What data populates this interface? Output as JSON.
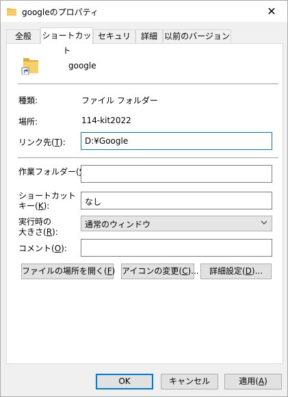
{
  "window": {
    "title": "googleのプロパティ",
    "close_glyph": "✕"
  },
  "tabs": [
    {
      "label": "全般"
    },
    {
      "label": "ショートカット",
      "active": true
    },
    {
      "label": "セキュリティ"
    },
    {
      "label": "詳細"
    },
    {
      "label": "以前のバージョン"
    }
  ],
  "header": {
    "name": "google"
  },
  "fields": {
    "type_label": "種類:",
    "type_value": "ファイル フォルダー",
    "location_label": "場所:",
    "location_value": "114-kit2022",
    "target_label_pre": "リンク先(",
    "target_label_key": "T",
    "target_label_post": "):",
    "target_value": "D:¥Google",
    "workdir_label_pre": "作業フォルダー(",
    "workdir_label_key": "S",
    "workdir_label_post": "):",
    "workdir_value": "",
    "shortcut_label_line1": "ショートカット",
    "shortcut_label_pre": "キー(",
    "shortcut_label_key": "K",
    "shortcut_label_post": "):",
    "shortcut_value": "なし",
    "run_label_line1": "実行時の",
    "run_label_pre": "大きさ(",
    "run_label_key": "R",
    "run_label_post": "):",
    "run_value": "通常のウィンドウ",
    "comment_label_pre": "コメント(",
    "comment_label_key": "O",
    "comment_label_post": "):",
    "comment_value": ""
  },
  "actions": {
    "open_location_pre": "ファイルの場所を開く(",
    "open_location_key": "F",
    "open_location_post": ")",
    "change_icon_pre": "アイコンの変更(",
    "change_icon_key": "C",
    "change_icon_post": ")...",
    "advanced_pre": "詳細設定(",
    "advanced_key": "D",
    "advanced_post": ")..."
  },
  "footer": {
    "ok": "OK",
    "cancel": "キャンセル",
    "apply_pre": "適用(",
    "apply_key": "A",
    "apply_post": ")"
  },
  "colors": {
    "accent": "#0078d7",
    "folder": "#f3c85a"
  },
  "icons": {
    "title": "folder-shortcut-icon",
    "folder": "folder-shortcut-icon",
    "close": "close-icon",
    "dropdown": "chevron-down-icon"
  }
}
